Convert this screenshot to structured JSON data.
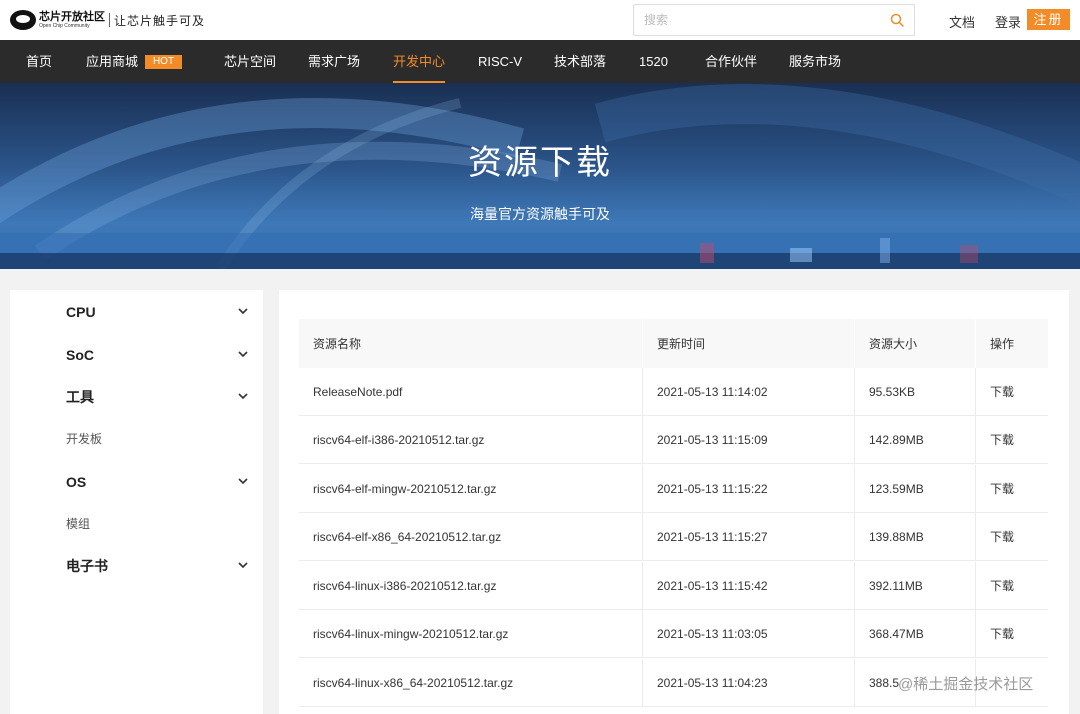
{
  "header": {
    "logo_cn": "芯片开放社区",
    "logo_en": "Open Chip Community",
    "slogan": "让芯片触手可及",
    "search_placeholder": "搜索",
    "docs_link": "文档",
    "login_link": "登录",
    "register_button": "注册"
  },
  "nav": {
    "items": [
      {
        "label": "首页"
      },
      {
        "label": "应用商城",
        "badge": "HOT"
      },
      {
        "label": "芯片空间"
      },
      {
        "label": "需求广场"
      },
      {
        "label": "开发中心",
        "active": true
      },
      {
        "label": "RISC-V"
      },
      {
        "label": "技术部落"
      },
      {
        "label": "1520"
      },
      {
        "label": "合作伙伴"
      },
      {
        "label": "服务市场"
      }
    ]
  },
  "banner": {
    "title": "资源下载",
    "subtitle": "海量官方资源触手可及"
  },
  "sidebar": {
    "items": [
      {
        "label": "CPU",
        "expandable": true
      },
      {
        "label": "SoC",
        "expandable": true
      },
      {
        "label": "工具",
        "expandable": true
      },
      {
        "label": "开发板",
        "expandable": false
      },
      {
        "label": "OS",
        "expandable": true
      },
      {
        "label": "模组",
        "expandable": false
      },
      {
        "label": "电子书",
        "expandable": true
      }
    ]
  },
  "table": {
    "columns": [
      "资源名称",
      "更新时间",
      "资源大小",
      "操作"
    ],
    "rows": [
      {
        "name": "ReleaseNote.pdf",
        "time": "2021-05-13 11:14:02",
        "size": "95.53KB",
        "action": "下载"
      },
      {
        "name": "riscv64-elf-i386-20210512.tar.gz",
        "time": "2021-05-13 11:15:09",
        "size": "142.89MB",
        "action": "下载"
      },
      {
        "name": "riscv64-elf-mingw-20210512.tar.gz",
        "time": "2021-05-13 11:15:22",
        "size": "123.59MB",
        "action": "下载"
      },
      {
        "name": "riscv64-elf-x86_64-20210512.tar.gz",
        "time": "2021-05-13 11:15:27",
        "size": "139.88MB",
        "action": "下载"
      },
      {
        "name": "riscv64-linux-i386-20210512.tar.gz",
        "time": "2021-05-13 11:15:42",
        "size": "392.11MB",
        "action": "下载"
      },
      {
        "name": "riscv64-linux-mingw-20210512.tar.gz",
        "time": "2021-05-13 11:03:05",
        "size": "368.47MB",
        "action": "下载"
      },
      {
        "name": "riscv64-linux-x86_64-20210512.tar.gz",
        "time": "2021-05-13 11:04:23",
        "size": "388.5",
        "action": ""
      }
    ]
  },
  "watermark": "@稀土掘金技术社区",
  "colors": {
    "accent": "#f28c28",
    "nav_bg": "#2b2b2b"
  }
}
